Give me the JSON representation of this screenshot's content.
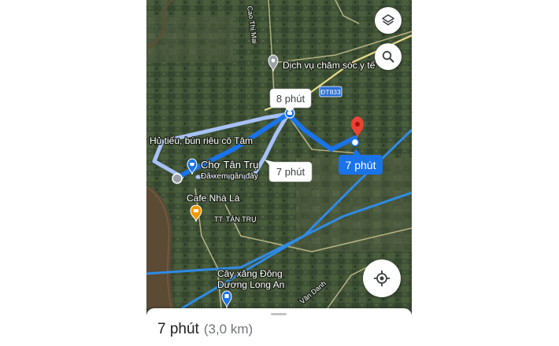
{
  "map": {
    "place_labels": {
      "cao_thi_mai": "Cao Thị Mai",
      "dich_vu": "Dịch vụ chăm sóc y tế",
      "hu_tieu": "Hủ tiếu, bún riêu cô Tâm",
      "cho_tan_tru": "Chợ Tân Trụ",
      "da_xem": "Đã xem gần đây",
      "cafe": "Cafe Nhà Lá",
      "tt_tan_tru": "TT. TÂN TRỤ",
      "cay_xang_1": "Cây xăng Đông",
      "cay_xang_2": "Dương Long An",
      "van_danh": "Văn Danh"
    },
    "road_shield": "ĐT833",
    "route_callouts": {
      "main": "7 phút",
      "alt_top": "8 phút",
      "alt_bottom": "7 phút"
    },
    "colors": {
      "route_primary": "#1a73e8",
      "route_alt": "#a7c2f8",
      "destination_pin": "#ea4335",
      "cafe_marker": "#f29900",
      "shop_marker": "#1a73e8",
      "major_road": "#2f8be6"
    },
    "controls": {
      "layers_icon": "layers-icon",
      "search_icon": "search-icon",
      "location_icon": "my-location-icon"
    }
  },
  "bottom_sheet": {
    "duration": "7 phút",
    "distance": "(3,0 km)"
  }
}
